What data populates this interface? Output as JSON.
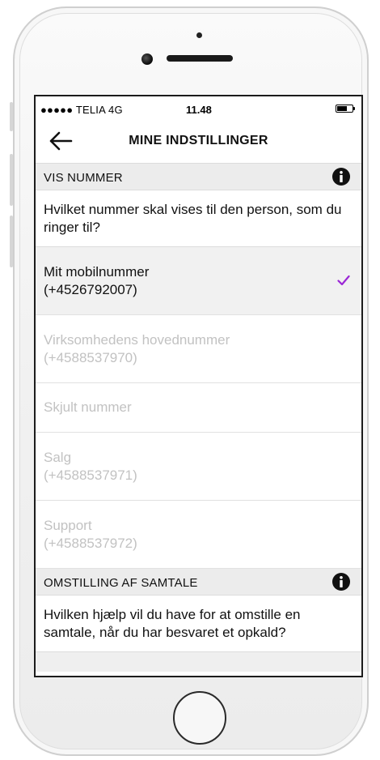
{
  "statusbar": {
    "carrier": "●●●●● TELIA  4G",
    "time": "11.48"
  },
  "navbar": {
    "back_icon": "arrow-left-icon",
    "title": "MINE INDSTILLINGER"
  },
  "sections": [
    {
      "header": "VIS NUMMER",
      "info_icon": "info-icon",
      "question": "Hvilket nummer skal vises til den person, som du ringer til?",
      "options": [
        {
          "line1": "Mit mobilnummer",
          "line2": "(+4526792007)",
          "selected": true
        },
        {
          "line1": "Virksomhedens hovednummer",
          "line2": "(+4588537970)",
          "selected": false
        },
        {
          "line1": "Skjult nummer",
          "line2": "",
          "selected": false
        },
        {
          "line1": "Salg",
          "line2": "(+4588537971)",
          "selected": false
        },
        {
          "line1": "Support",
          "line2": "(+4588537972)",
          "selected": false
        }
      ]
    },
    {
      "header": "OMSTILLING AF SAMTALE",
      "info_icon": "info-icon",
      "question": "Hvilken hjælp vil du have for at omstille en samtale, når du har besvaret et opkald?"
    }
  ],
  "colors": {
    "check": "#9b27d6",
    "header_bg": "#ececec",
    "selected_bg": "#f1f1f1",
    "disabled_text": "#c2c2c2"
  }
}
